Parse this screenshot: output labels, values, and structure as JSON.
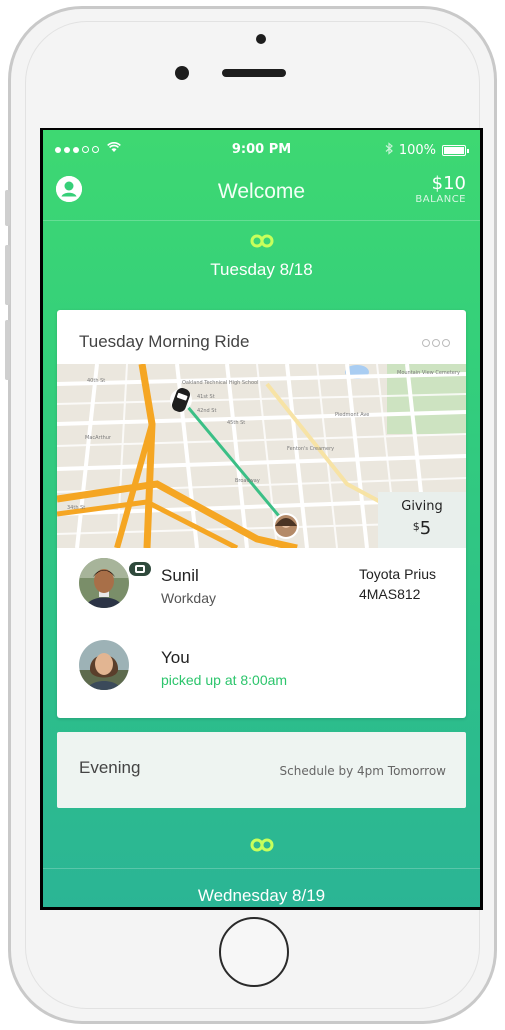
{
  "status_bar": {
    "time": "9:00 PM",
    "battery": "100%"
  },
  "header": {
    "title": "Welcome",
    "balance_amount": "$10",
    "balance_label": "BALANCE"
  },
  "days": [
    {
      "title": "Tuesday 8/18"
    },
    {
      "title": "Wednesday 8/19"
    }
  ],
  "ride": {
    "title": "Tuesday Morning Ride",
    "giving_label": "Giving",
    "giving_currency": "$",
    "giving_amount": "5",
    "driver": {
      "name": "Sunil",
      "company": "Workday",
      "car_model": "Toyota Prius",
      "plate": "4MAS812"
    },
    "rider": {
      "name": "You",
      "status": "picked up at 8:00am"
    }
  },
  "evening": {
    "title": "Evening",
    "schedule": "Schedule by 4pm Tomorrow"
  },
  "map_labels": {
    "school": "Oakland Technical High School",
    "macarthur": "MacArthur",
    "creamery": "Fenton's Creamery",
    "cemetery": "Mountain View Cemetery",
    "st_40": "40th St",
    "st_41": "41st St",
    "st_42": "42nd St",
    "st_45": "45th St",
    "st_34": "34th St",
    "broadway": "Broadway",
    "piedmont": "Piedmont Ave"
  },
  "colors": {
    "brand_green": "#3ed872",
    "accent_green": "#2cc56c",
    "route": "#3bbf86"
  }
}
